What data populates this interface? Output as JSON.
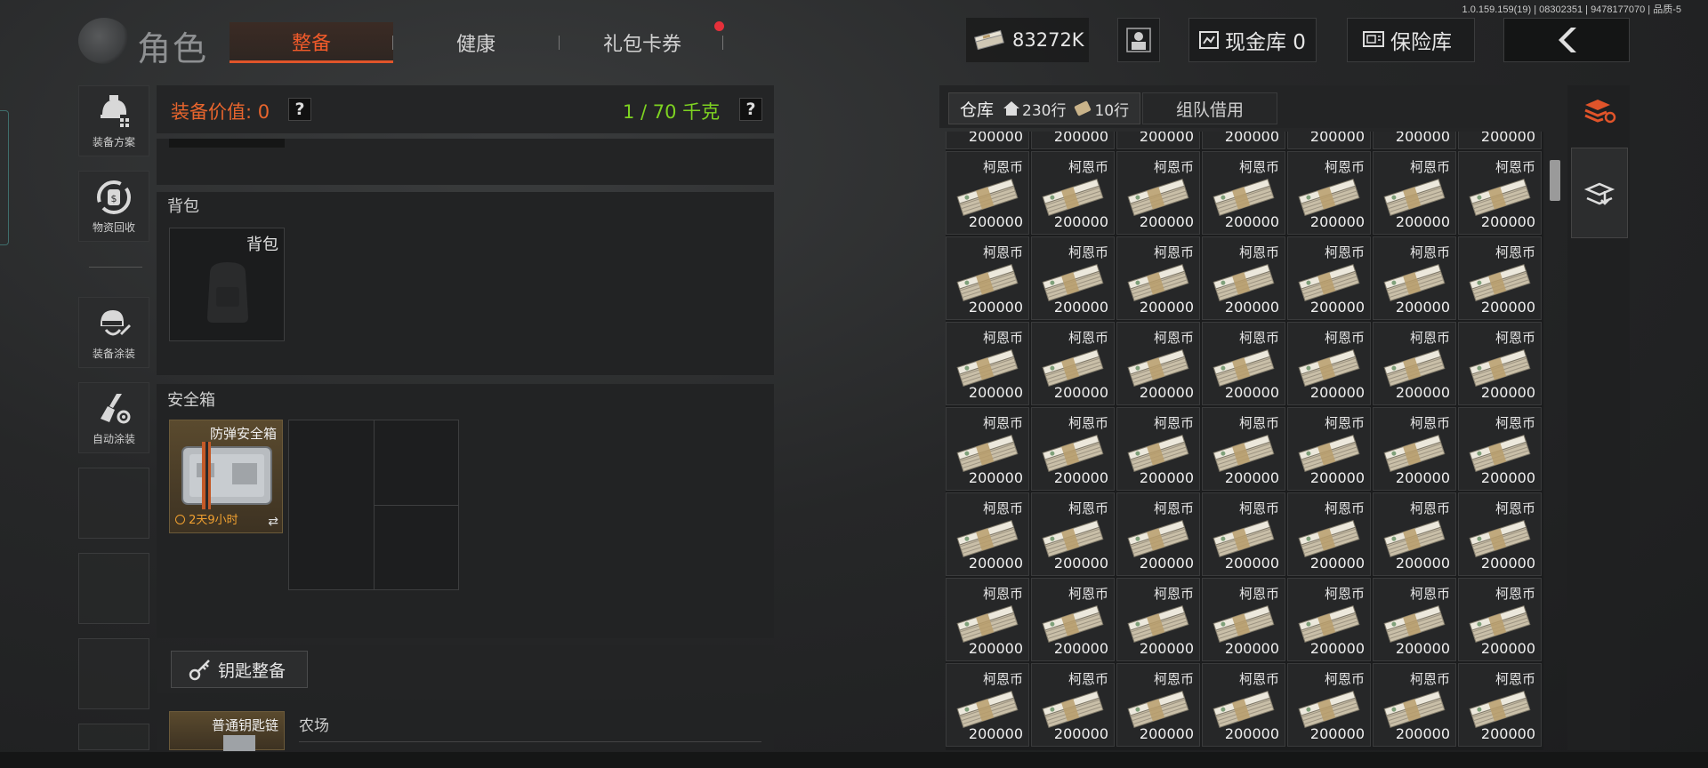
{
  "version": "1.0.159.159(19) | 08302351 | 9478177070 | 品质-5",
  "header": {
    "title": "角色",
    "tabs": [
      {
        "label": "整备",
        "active": true
      },
      {
        "label": "健康",
        "active": false
      },
      {
        "label": "礼包卡券",
        "active": false,
        "notification": true
      }
    ],
    "currency": {
      "amount": "83272K",
      "icon": "cash-stack-icon"
    },
    "cash_vault": "现金库 0",
    "insurance_vault": "保险库",
    "back_icon": "chevron-left-icon"
  },
  "sidebar": {
    "items": [
      {
        "label": "装备方案",
        "icon": "helmet-plan-icon"
      },
      {
        "label": "物资回收",
        "icon": "recycle-icon"
      },
      {
        "label": "装备涂装",
        "icon": "helmet-paint-icon"
      },
      {
        "label": "自动涂装",
        "icon": "brush-gear-icon"
      }
    ]
  },
  "gear": {
    "value_label": "装备价值: 0",
    "weight_label": "1 / 70 千克",
    "help": "?",
    "backpack_section": "背包",
    "backpack_slot": "背包",
    "safebox_section": "安全箱",
    "safebox_item": {
      "name": "防弹安全箱",
      "timer": "2天9小时"
    },
    "key_button": "钥匙整备",
    "keychain": {
      "name": "普通钥匙链",
      "map": "农场"
    }
  },
  "warehouse": {
    "tabs": [
      {
        "label": "仓库",
        "active": true
      },
      {
        "label": "230行",
        "icon": "home-icon"
      },
      {
        "label": "10行",
        "icon": "ticket-icon"
      },
      {
        "label": "组队借用",
        "active": false
      }
    ],
    "item_name": "柯恩币",
    "item_amount": "200000",
    "columns": 7,
    "rows": 7
  },
  "colors": {
    "accent": "#e0542a",
    "weight_green": "#7ed321",
    "value_orange": "#e8652d"
  }
}
